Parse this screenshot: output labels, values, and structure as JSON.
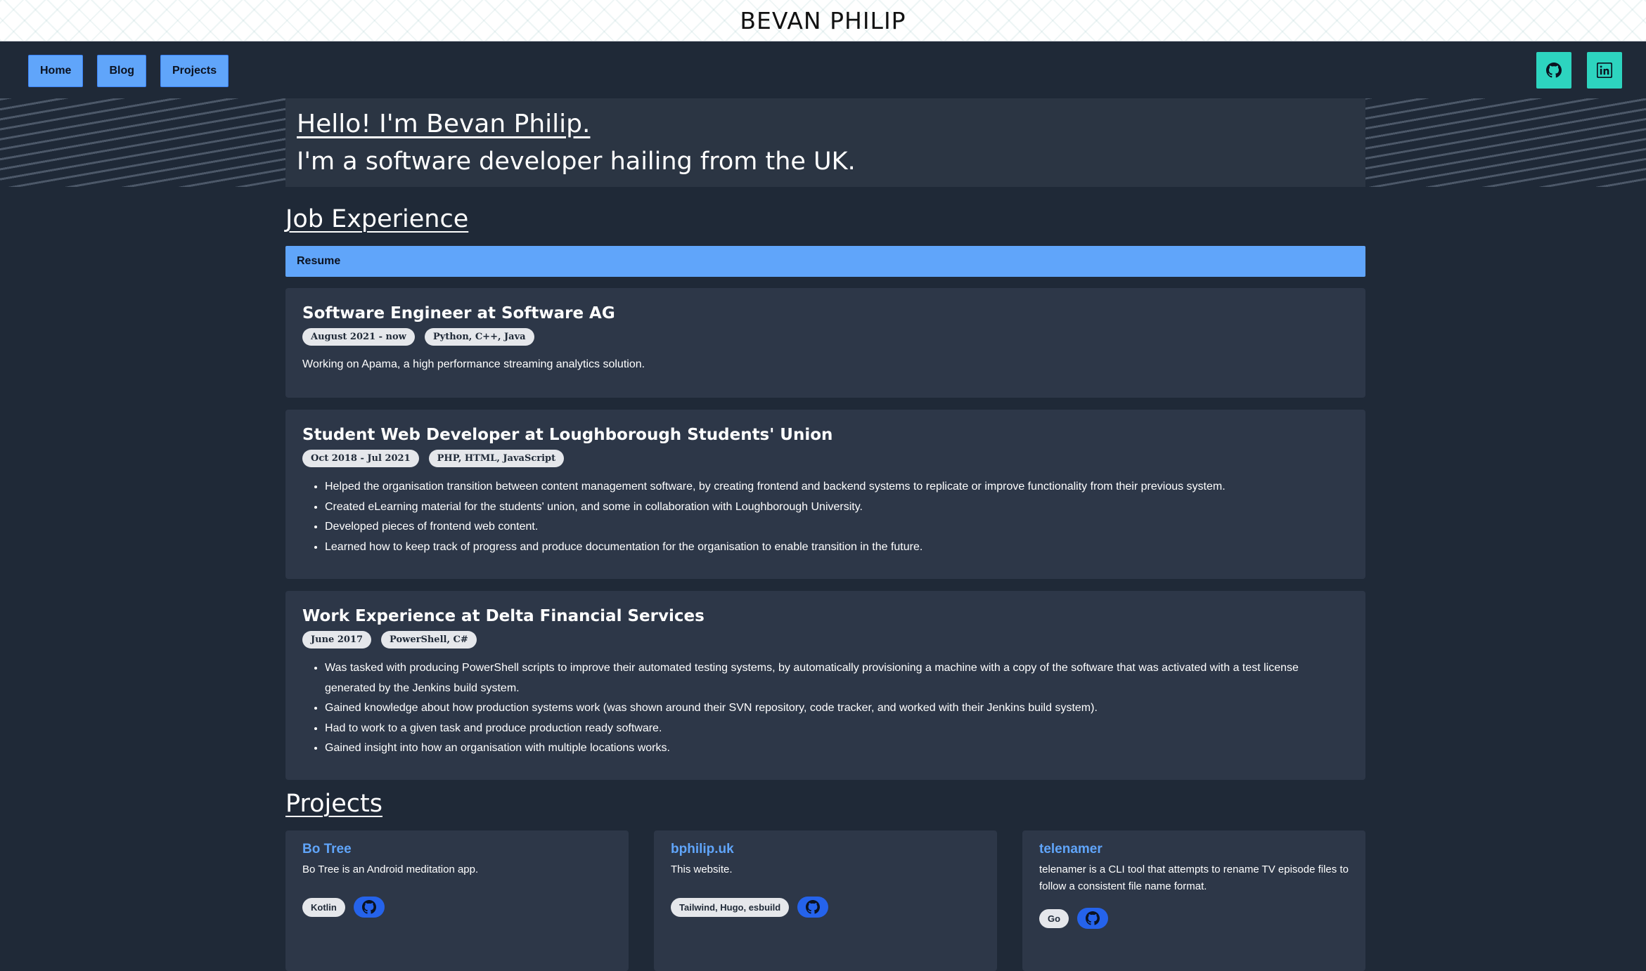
{
  "header": {
    "name": "BEVAN PHILIP"
  },
  "nav": {
    "home": "Home",
    "blog": "Blog",
    "projects": "Projects"
  },
  "social": {
    "github_icon": "github-icon",
    "linkedin_icon": "linkedin-icon",
    "accent": "#2dd4bf"
  },
  "hero": {
    "line1": "Hello! I'm Bevan Philip.",
    "line2": "I'm a software developer hailing from the UK."
  },
  "job_section": {
    "title": "Job Experience",
    "resume_label": "Resume",
    "jobs": [
      {
        "title": "Software Engineer at Software AG",
        "tags": [
          "August 2021 - now",
          "Python, C++, Java"
        ],
        "description": "Working on Apama, a high performance streaming analytics solution."
      },
      {
        "title": "Student Web Developer at Loughborough Students' Union",
        "tags": [
          "Oct 2018 - Jul 2021",
          "PHP, HTML, JavaScript"
        ],
        "bullets": [
          "Helped the organisation transition between content management software, by creating frontend and backend systems to replicate or improve functionality from their previous system.",
          "Created eLearning material for the students' union, and some in collaboration with Loughborough University.",
          "Developed pieces of frontend web content.",
          "Learned how to keep track of progress and produce documentation for the organisation to enable transition in the future."
        ]
      },
      {
        "title": "Work Experience at Delta Financial Services",
        "tags": [
          "June 2017",
          "PowerShell, C#"
        ],
        "bullets": [
          "Was tasked with producing PowerShell scripts to improve their automated testing systems, by automatically provisioning a machine with a copy of the software that was activated with a test license generated by the Jenkins build system.",
          "Gained knowledge about how production systems work (was shown around their SVN repository, code tracker, and worked with their Jenkins build system).",
          "Had to work to a given task and produce production ready software.",
          "Gained insight into how an organisation with multiple locations works."
        ]
      }
    ]
  },
  "projects_section": {
    "title": "Projects",
    "projects": [
      {
        "title": "Bo Tree",
        "description": "Bo Tree is an Android meditation app.",
        "tag": "Kotlin"
      },
      {
        "title": "bphilip.uk",
        "description": "This website.",
        "tag": "Tailwind, Hugo, esbuild"
      },
      {
        "title": "telenamer",
        "description": "telenamer is a CLI tool that attempts to rename TV episode files to follow a consistent file name format.",
        "tag": "Go"
      }
    ]
  }
}
